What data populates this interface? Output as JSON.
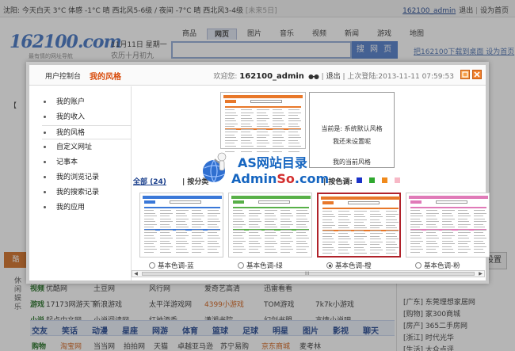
{
  "topbar": {
    "weather_text": "沈阳: 今天白天 3°C 体感 -1°C 晴 西北风5-6级 / 夜间 -7°C 晴 西北风3-4级",
    "weather_more": "[未来5日]",
    "username": "162100_admin",
    "logout": "退出",
    "home": "设为首页"
  },
  "header": {
    "logo": "162100.com",
    "slogan": "最有情的网址导航",
    "date_line1": "11月11日 星期一",
    "date_line2": "农历十月初九",
    "search_tabs": [
      {
        "label": "商品"
      },
      {
        "label": "网页"
      },
      {
        "label": "图片"
      },
      {
        "label": "音乐"
      },
      {
        "label": "视频"
      },
      {
        "label": "新闻"
      },
      {
        "label": "游戏"
      },
      {
        "label": "地图"
      }
    ],
    "active_tab_index": 1,
    "search_button": "搜 网 页",
    "set_links": "把162100下载到桌面 设为首页"
  },
  "background": {
    "left_stub": "【",
    "side_tab": "酷",
    "side_category": "休闲娱乐",
    "rows": [
      {
        "head": "视频",
        "links": [
          "优酷网",
          "土豆网",
          "风行网",
          "爱奇艺高清",
          "迅雷看看"
        ]
      },
      {
        "head": "游戏",
        "links": [
          "17173网游天下",
          "新浪游戏",
          "太平洋游戏网",
          "4399小游戏",
          "TOM游戏",
          "7k7k小游戏"
        ]
      },
      {
        "head": "小说",
        "links": [
          "起点中文网",
          "小说阅读网",
          "红袖添香",
          "潇湘书院",
          "幻剑书盟",
          "言情小说吧"
        ]
      }
    ],
    "bluebar": [
      "交友",
      "笑话",
      "动漫",
      "星座",
      "网游",
      "体育",
      "篮球",
      "足球",
      "明星",
      "图片",
      "影视",
      "聊天"
    ],
    "lastrow": [
      "购物",
      "淘宝网",
      "当当网",
      "拍拍网",
      "天猫",
      "卓越亚马逊",
      "苏宁易购",
      "京东商城",
      "麦考林"
    ],
    "right_button": "设置",
    "right_items": [
      "[广东] 东莞理想家居网",
      "[购物] 家300商城",
      "[房产] 365二手房网",
      "[浙江] 时代光华",
      "[生活] 大众点评"
    ]
  },
  "modal": {
    "tabs": [
      "用户控制台",
      "我的风格"
    ],
    "welcome_prefix": "欢迎您:",
    "welcome_name": "162100_admin",
    "logout": "退出",
    "last_login": "上次登陆:2013-11-11 07:59:53",
    "nav": [
      "我的账户",
      "我的收入",
      "我的风格",
      "自定义网址",
      "记事本",
      "我的浏览记录",
      "我的搜索记录",
      "我的应用"
    ],
    "active_nav_index": 2,
    "current": {
      "line1": "当前是: 系统默认风格",
      "line2": "我还未设置呢",
      "caption": "我的当前风格"
    },
    "filter": {
      "all": "全部 (24)",
      "by_category": "| 按分类",
      "by_color": "| 按色调:",
      "swatches": [
        "#1a32c8",
        "#2fa82f",
        "#f08a1c",
        "#f7b8c6"
      ]
    },
    "themes": [
      {
        "label": "基本色调-蓝",
        "color": "#3a78d8",
        "selected": false
      },
      {
        "label": "基本色调-绿",
        "color": "#58b048",
        "selected": false
      },
      {
        "label": "基本色调-橙",
        "color": "#e8782a",
        "selected": true
      },
      {
        "label": "基本色调-粉",
        "color": "#e07ab8",
        "selected": false
      }
    ],
    "scroll_grip": "III"
  },
  "watermark": {
    "line1": "AS网站目录",
    "line2a": "Admin",
    "line2b": "So",
    "line2c": ".com"
  }
}
